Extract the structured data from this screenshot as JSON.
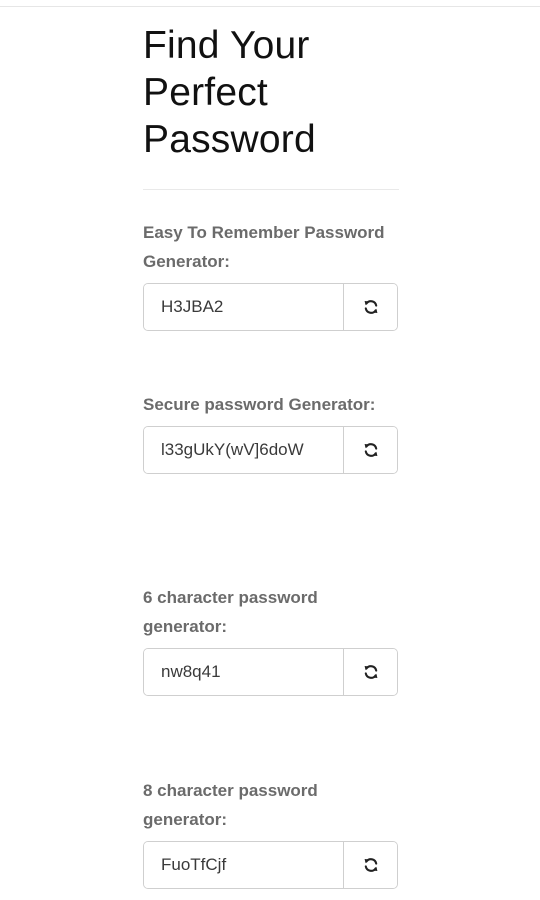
{
  "page": {
    "title": "Find Your Perfect Password"
  },
  "generators": [
    {
      "label": "Easy To Remember Password Generator:",
      "value": "H3JBA2",
      "button_icon": "refresh-icon"
    },
    {
      "label": "Secure password Generator:",
      "value": "l33gUkY(wV]6doW",
      "button_icon": "refresh-icon"
    },
    {
      "label": "6 character password generator:",
      "value": "nw8q41",
      "button_icon": "refresh-icon"
    },
    {
      "label": "8 character password generator:",
      "value": "FuoTfCjf",
      "button_icon": "refresh-icon"
    }
  ],
  "colors": {
    "title": "#111111",
    "label": "#6b6b6b",
    "border": "#cfcfcf",
    "value": "#3a3a3a"
  }
}
